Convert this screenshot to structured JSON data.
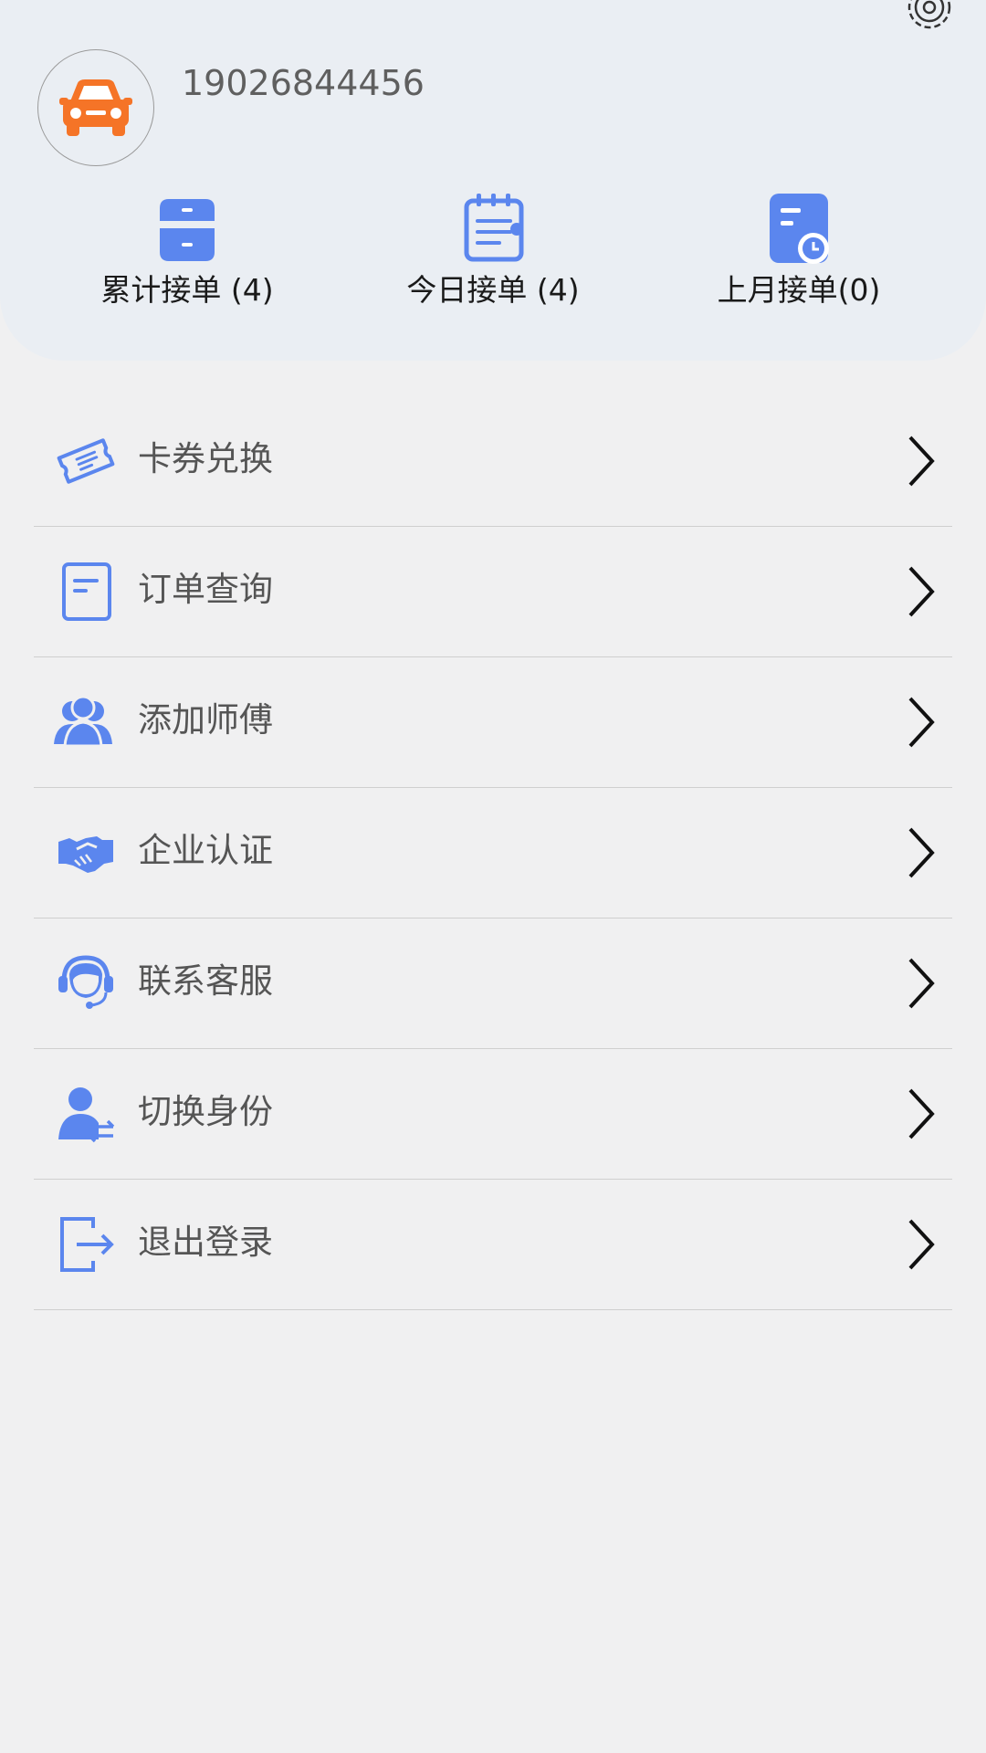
{
  "profile": {
    "phone": "19026844456",
    "avatar_icon": "car-icon",
    "avatar_color": "#f57427"
  },
  "header": {
    "settings_icon": "gear-icon"
  },
  "stats": [
    {
      "label": "累计接单 (4)",
      "icon": "drawer-cabinet-icon"
    },
    {
      "label": "今日接单 (4)",
      "icon": "calendar-icon"
    },
    {
      "label": "上月接单(0)",
      "icon": "document-clock-icon"
    }
  ],
  "menu": [
    {
      "label": "卡券兑换",
      "icon": "ticket-icon"
    },
    {
      "label": "订单查询",
      "icon": "order-document-icon"
    },
    {
      "label": "添加师傅",
      "icon": "users-icon"
    },
    {
      "label": "企业认证",
      "icon": "handshake-icon"
    },
    {
      "label": "联系客服",
      "icon": "customer-service-icon"
    },
    {
      "label": "切换身份",
      "icon": "user-switch-icon"
    },
    {
      "label": "退出登录",
      "icon": "logout-icon"
    }
  ],
  "colors": {
    "accent": "#5b86ee",
    "header_bg": "#eaeef3",
    "page_bg": "#f0f0f1"
  }
}
